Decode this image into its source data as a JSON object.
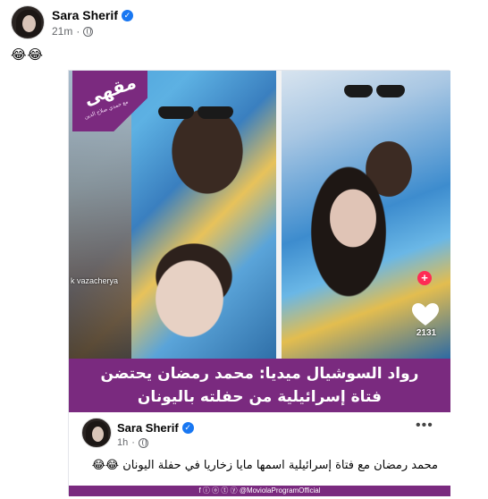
{
  "post": {
    "author": "Sara Sherif",
    "time": "21m",
    "caption": "😂😂"
  },
  "card": {
    "logo_word": "مقهى",
    "logo_sub": "مع حمدي صلاح الدين",
    "tiktok_handle": "k  vazacherya",
    "likes": "2131",
    "headline_line1": "رواد السوشيال ميديا: محمد رمضان  يحتضن",
    "headline_line2": "فتاة إسرائيلية من حفلته باليونان",
    "inner": {
      "author": "Sara Sherif",
      "time": "1h",
      "more": "•••",
      "text": "محمد رمضان مع فتاة إسرائيلية اسمها مايا زخاريا في حفلة اليونان 😂😂"
    },
    "footer": "f ⓘ ⓞ ⓣ ⓨ @MoviolaProgramOfficial"
  },
  "colors": {
    "brand_purple": "#7a2a7f",
    "verified_blue": "#1877f2",
    "tiktok_red": "#fe2c55"
  }
}
